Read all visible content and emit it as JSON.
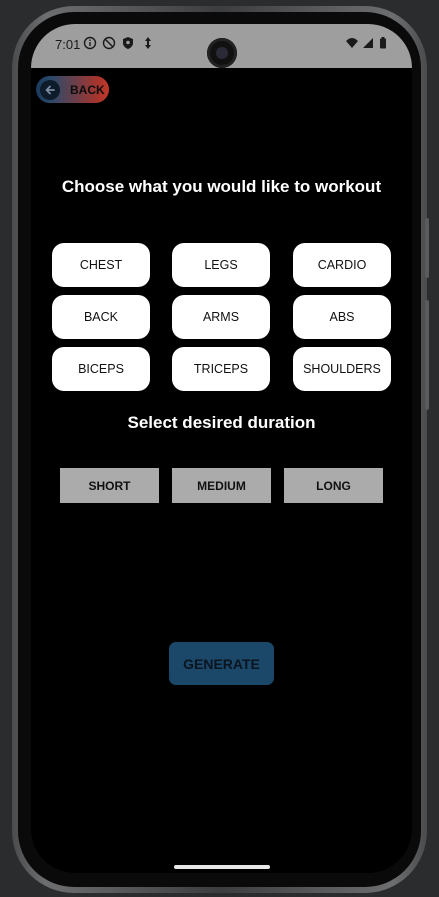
{
  "status_bar": {
    "time": "7:01",
    "icons": [
      "info-icon",
      "no-disturb-icon",
      "shield-icon",
      "data-icon",
      "wifi-icon",
      "signal-icon",
      "battery-icon"
    ]
  },
  "back_button": {
    "label": "BACK",
    "icon": "arrow-left-icon"
  },
  "workout": {
    "heading": "Choose what you would like to workout",
    "options": [
      "CHEST",
      "LEGS",
      "CARDIO",
      "BACK",
      "ARMS",
      "ABS",
      "BICEPS",
      "TRICEPS",
      "SHOULDERS"
    ]
  },
  "duration": {
    "heading": "Select desired duration",
    "options": [
      "SHORT",
      "MEDIUM",
      "LONG"
    ]
  },
  "generate_button": {
    "label": "GENERATE"
  },
  "colors": {
    "screen_bg": "#000000",
    "pill_bg": "#ffffff",
    "duration_bg": "#ababab",
    "generate_bg": "#1b4769",
    "status_bar_bg": "#9e9e9e"
  }
}
